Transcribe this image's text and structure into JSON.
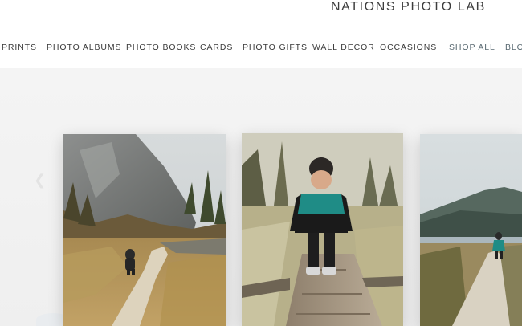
{
  "brand": {
    "name": "NATIONS PHOTO LAB"
  },
  "nav": {
    "items": [
      {
        "label": "PRINTS"
      },
      {
        "label": "PHOTO ALBUMS"
      },
      {
        "label": "PHOTO BOOKS"
      },
      {
        "label": "CARDS"
      },
      {
        "label": "PHOTO GIFTS"
      },
      {
        "label": "WALL DECOR"
      },
      {
        "label": "OCCASIONS"
      },
      {
        "label": "SHOP ALL"
      },
      {
        "label": "BLO"
      }
    ]
  },
  "carousel": {
    "prev_icon": "chevron-left-icon",
    "slides": [
      {
        "subject": "child-walking-mountain-trail"
      },
      {
        "subject": "child-in-green-jacket-on-log"
      },
      {
        "subject": "child-running-on-lake-path"
      }
    ]
  },
  "colors": {
    "text": "#3a3a3a",
    "stage_bg": "#f2f2f2",
    "jacket_green": "#1f8c86"
  }
}
